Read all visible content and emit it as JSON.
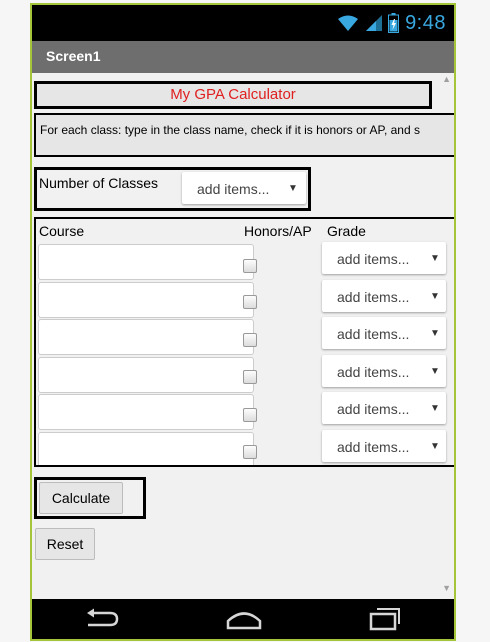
{
  "status_bar": {
    "time": "9:48",
    "icons": [
      "wifi-icon",
      "cell-signal-icon",
      "battery-icon"
    ],
    "clock_color": "#39a8e0"
  },
  "screen": {
    "title": "Screen1"
  },
  "app": {
    "title": "My GPA Calculator",
    "title_color": "#e02020",
    "instructions": "For each class: type in the class name, check if it is honors or AP, and s",
    "num_classes_label": "Number of Classes",
    "num_classes_dropdown": {
      "value": "add items...",
      "arrow": "▼"
    },
    "table": {
      "headers": {
        "course": "Course",
        "honors": "Honors/AP",
        "grade": "Grade"
      },
      "rows": [
        {
          "course": "",
          "honors": false,
          "grade": "add items...",
          "arrow": "▼"
        },
        {
          "course": "",
          "honors": false,
          "grade": "add items...",
          "arrow": "▼"
        },
        {
          "course": "",
          "honors": false,
          "grade": "add items...",
          "arrow": "▼"
        },
        {
          "course": "",
          "honors": false,
          "grade": "add items...",
          "arrow": "▼"
        },
        {
          "course": "",
          "honors": false,
          "grade": "add items...",
          "arrow": "▼"
        },
        {
          "course": "",
          "honors": false,
          "grade": "add items...",
          "arrow": "▼"
        }
      ]
    },
    "buttons": {
      "calculate": "Calculate",
      "reset": "Reset"
    }
  },
  "nav_bar": {
    "icons": [
      "back-icon",
      "home-icon",
      "recent-apps-icon"
    ]
  },
  "accent_color": "#a4c439"
}
